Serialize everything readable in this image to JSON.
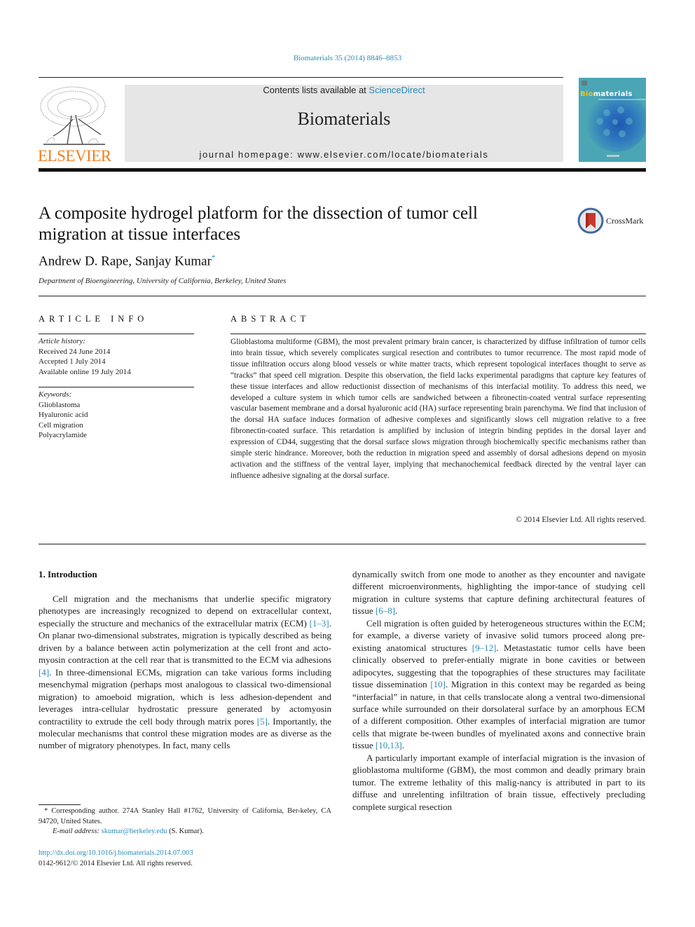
{
  "journal_ref": "Biomaterials 35 (2014) 8846–8853",
  "header": {
    "contents_prefix": "Contents lists available at ",
    "contents_link": "ScienceDirect",
    "journal_title": "Biomaterials",
    "homepage": "journal homepage: www.elsevier.com/locate/biomaterials",
    "publisher_logo_text": "ELSEVIER",
    "cover_title_highlight": "Bio",
    "cover_title_rest": "materials"
  },
  "colors": {
    "link": "#2a8bb8",
    "elsevier_orange": "#f07f1e",
    "banner_bg": "#e6e6e6",
    "cover_bg": "#4aa6b4",
    "crossmark_red": "#c8372d"
  },
  "article": {
    "title": "A composite hydrogel platform for the dissection of tumor cell migration at tissue interfaces",
    "authors": "Andrew D. Rape, Sanjay Kumar",
    "author_mark": "*",
    "affiliation": "Department of Bioengineering, University of California, Berkeley, United States",
    "crossmark_label": "CrossMark"
  },
  "article_info": {
    "heading": "ARTICLE INFO",
    "history_label": "Article history:",
    "history": [
      "Received 24 June 2014",
      "Accepted 1 July 2014",
      "Available online 19 July 2014"
    ],
    "keywords_label": "Keywords:",
    "keywords": [
      "Glioblastoma",
      "Hyaluronic acid",
      "Cell migration",
      "Polyacrylamide"
    ]
  },
  "abstract": {
    "heading": "ABSTRACT",
    "text": "Glioblastoma multiforme (GBM), the most prevalent primary brain cancer, is characterized by diffuse infiltration of tumor cells into brain tissue, which severely complicates surgical resection and contributes to tumor recurrence. The most rapid mode of tissue infiltration occurs along blood vessels or white matter tracts, which represent topological interfaces thought to serve as “tracks” that speed cell migration. Despite this observation, the field lacks experimental paradigms that capture key features of these tissue interfaces and allow reductionist dissection of mechanisms of this interfacial motility. To address this need, we developed a culture system in which tumor cells are sandwiched between a fibronectin-coated ventral surface representing vascular basement membrane and a dorsal hyaluronic acid (HA) surface representing brain parenchyma. We find that inclusion of the dorsal HA surface induces formation of adhesive complexes and significantly slows cell migration relative to a free fibronectin-coated surface. This retardation is amplified by inclusion of integrin binding peptides in the dorsal layer and expression of CD44, suggesting that the dorsal surface slows migration through biochemically specific mechanisms rather than simple steric hindrance. Moreover, both the reduction in migration speed and assembly of dorsal adhesions depend on myosin activation and the stiffness of the ventral layer, implying that mechanochemical feedback directed by the ventral layer can influence adhesive signaling at the dorsal surface.",
    "copyright": "© 2014 Elsevier Ltd. All rights reserved."
  },
  "introduction": {
    "heading": "1.  Introduction",
    "col1": {
      "p1_a": "Cell migration and the mechanisms that underlie specific migratory phenotypes are increasingly recognized to depend on extracellular context, especially the structure and mechanics of the extracellular matrix (ECM) ",
      "ref1": "[1–3]",
      "p1_b": ". On planar two-dimensional substrates, migration is typically described as being driven by a balance between actin polymerization at the cell front and acto-myosin contraction at the cell rear that is transmitted to the ECM via adhesions ",
      "ref2": "[4]",
      "p1_c": ". In three-dimensional ECMs, migration can take various forms including mesenchymal migration (perhaps most analogous to classical two-dimensional migration) to amoeboid migration, which is less adhesion-dependent and leverages intra-cellular hydrostatic pressure generated by actomyosin contractility to extrude the cell body through matrix pores ",
      "ref3": "[5]",
      "p1_d": ". Importantly, the molecular mechanisms that control these migration modes are as diverse as the number of migratory phenotypes. In fact, many cells"
    },
    "col2": {
      "p1_a": "dynamically switch from one mode to another as they encounter and navigate different microenvironments, highlighting the impor-tance of studying cell migration in culture systems that capture defining architectural features of tissue ",
      "ref1": "[6–8]",
      "p1_b": ".",
      "p2_a": "Cell migration is often guided by heterogeneous structures within the ECM; for example, a diverse variety of invasive solid tumors proceed along pre-existing anatomical structures ",
      "ref2": "[9–12]",
      "p2_b": ". Metastastatic tumor cells have been clinically observed to prefer-entially migrate in bone cavities or between adipocytes, suggesting that the topographies of these structures may facilitate tissue dissemination ",
      "ref3": "[10]",
      "p2_c": ". Migration in this context may be regarded as being “interfacial” in nature, in that cells translocate along a ventral two-dimensional surface while surrounded on their dorsolateral surface by an amorphous ECM of a different composition. Other examples of interfacial migration are tumor cells that migrate be-tween bundles of myelinated axons and connective brain tissue ",
      "ref4": "[10,13]",
      "p2_d": ".",
      "p3": "A particularly important example of interfacial migration is the invasion of glioblastoma multiforme (GBM), the most common and deadly primary brain tumor. The extreme lethality of this malig-nancy is attributed in part to its diffuse and unrelenting infiltration of brain tissue, effectively precluding complete surgical resection"
    }
  },
  "footnote": {
    "mark": "*",
    "corresponding": " Corresponding author. 274A Stanley Hall #1762, University of California, Ber-keley, CA 94720, United States.",
    "email_label": "E-mail address: ",
    "email": "skumar@berkeley.edu",
    "email_suffix": " (S. Kumar)."
  },
  "doi": {
    "url": "http://dx.doi.org/10.1016/j.biomaterials.2014.07.003",
    "issn_line": "0142-9612/© 2014 Elsevier Ltd. All rights reserved."
  }
}
